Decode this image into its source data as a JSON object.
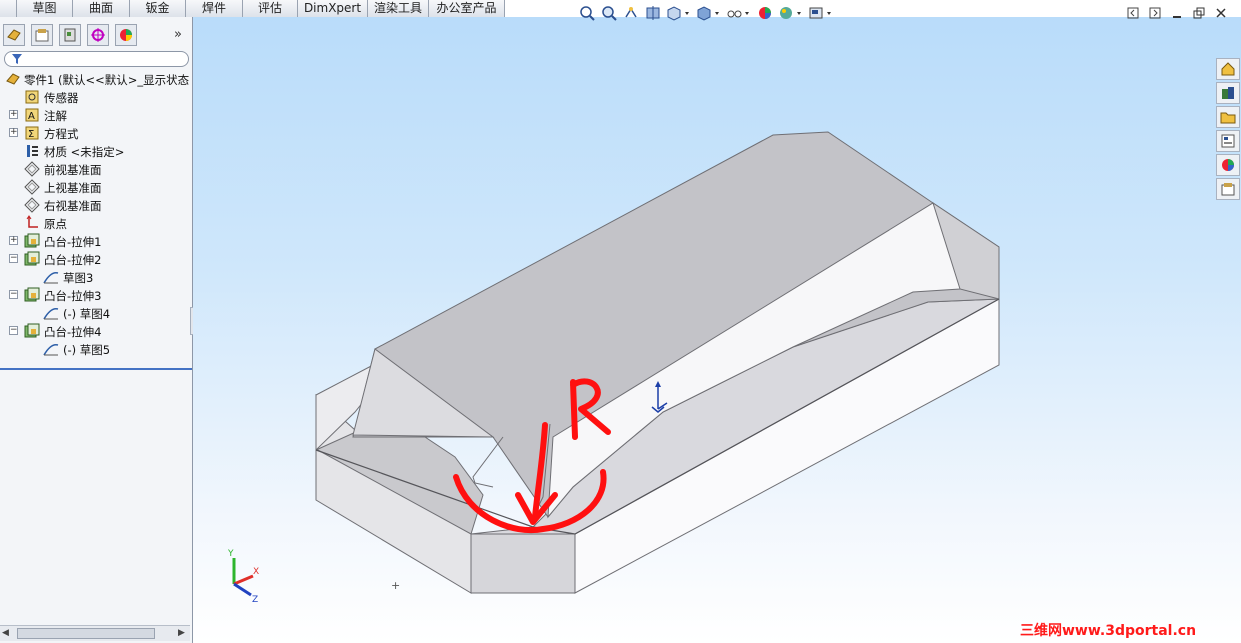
{
  "command_tabs": [
    "草图",
    "曲面",
    "钣金",
    "焊件",
    "评估",
    "DimXpert",
    "渲染工具",
    "办公室产品"
  ],
  "feature_tree": {
    "root": "零件1 (默认<<默认>_显示状态",
    "items": [
      {
        "label": "传感器",
        "icon": "sensor-icon"
      },
      {
        "label": "注解",
        "icon": "annotation-icon"
      },
      {
        "label": "方程式",
        "icon": "equation-icon"
      },
      {
        "label": "材质 <未指定>",
        "icon": "material-icon"
      },
      {
        "label": "前视基准面",
        "icon": "plane-icon"
      },
      {
        "label": "上视基准面",
        "icon": "plane-icon"
      },
      {
        "label": "右视基准面",
        "icon": "plane-icon"
      },
      {
        "label": "原点",
        "icon": "origin-icon"
      },
      {
        "label": "凸台-拉伸1",
        "icon": "boss-extrude-icon"
      },
      {
        "label": "凸台-拉伸2",
        "icon": "boss-extrude-icon"
      },
      {
        "label": "草图3",
        "icon": "sketch-icon"
      },
      {
        "label": "凸台-拉伸3",
        "icon": "boss-extrude-icon"
      },
      {
        "label": "(-) 草图4",
        "icon": "sketch-icon"
      },
      {
        "label": "凸台-拉伸4",
        "icon": "boss-extrude-icon"
      },
      {
        "label": "(-) 草图5",
        "icon": "sketch-icon"
      }
    ]
  },
  "annotation": {
    "letter": "R"
  },
  "triad": {
    "x": "X",
    "y": "Y",
    "z": "Z"
  },
  "watermark": "三维网www.3dportal.cn",
  "colors": {
    "accent": "#4472c4",
    "markup": "#ff1010"
  }
}
